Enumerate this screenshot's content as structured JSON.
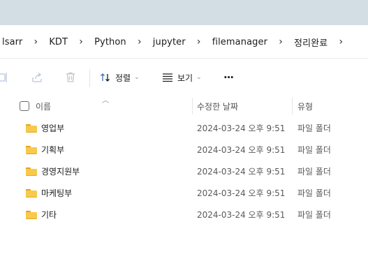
{
  "breadcrumb": {
    "items": [
      "lsarr",
      "KDT",
      "Python",
      "jupyter",
      "filemanager",
      "정리완료"
    ],
    "separator": "›"
  },
  "toolbar": {
    "sort_label": "정렬",
    "view_label": "보기",
    "more_label": "···"
  },
  "columns": {
    "name": "이름",
    "modified": "수정한 날짜",
    "type": "유형"
  },
  "files": [
    {
      "name": "영업부",
      "modified": "2024-03-24 오후 9:51",
      "type": "파일 폴더"
    },
    {
      "name": "기획부",
      "modified": "2024-03-24 오후 9:51",
      "type": "파일 폴더"
    },
    {
      "name": "경영지원부",
      "modified": "2024-03-24 오후 9:51",
      "type": "파일 폴더"
    },
    {
      "name": "마케팅부",
      "modified": "2024-03-24 오후 9:51",
      "type": "파일 폴더"
    },
    {
      "name": "기타",
      "modified": "2024-03-24 오후 9:51",
      "type": "파일 폴더"
    }
  ],
  "colors": {
    "title_strip": "#d3dde4",
    "folder": "#f8c94a",
    "icon_blue": "#3b6fb6"
  }
}
